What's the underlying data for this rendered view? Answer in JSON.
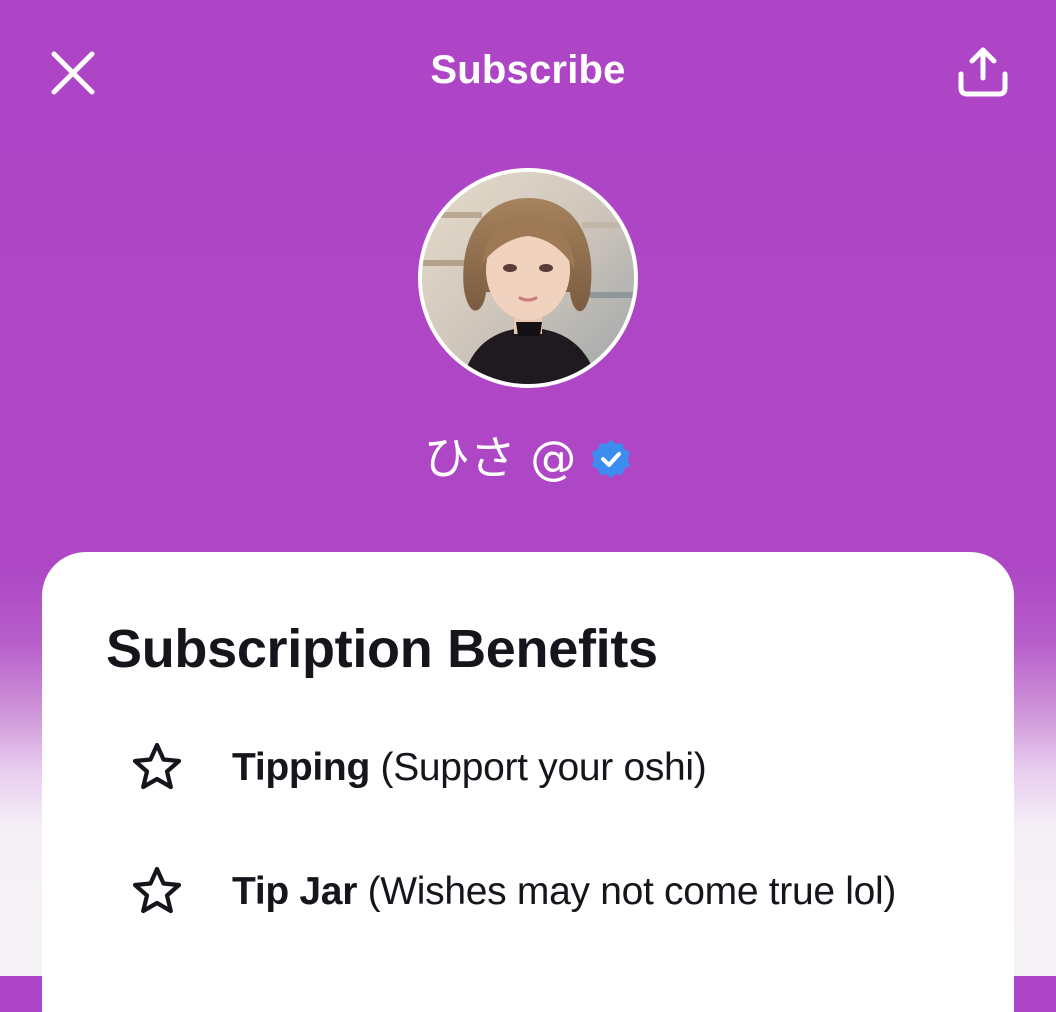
{
  "header": {
    "title": "Subscribe",
    "close_icon": "close-icon",
    "share_icon": "share-icon"
  },
  "profile": {
    "name": "ひさ @",
    "verified": true,
    "verified_icon": "verified-badge-icon",
    "avatar": "profile-photo"
  },
  "card": {
    "title": "Subscription Benefits",
    "benefits": [
      {
        "icon": "star-icon",
        "label": "Tipping",
        "detail": " (Support your oshi)"
      },
      {
        "icon": "star-icon",
        "label": "Tip Jar",
        "detail": " (Wishes may not come true lol)"
      }
    ]
  },
  "colors": {
    "header_background": "#ad45c6",
    "verified_badge": "#3d8df0",
    "card_background": "#ffffff",
    "text_primary": "#15161b"
  }
}
